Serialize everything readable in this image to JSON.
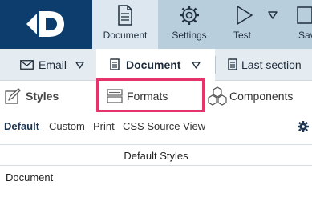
{
  "toolbar": {
    "document_label": "Document",
    "settings_label": "Settings",
    "test_label": "Test",
    "save_label": "Sav"
  },
  "tabs": {
    "email_label": "Email",
    "document_label": "Document",
    "last_section_label": "Last section"
  },
  "subtabs": {
    "styles_label": "Styles",
    "formats_label": "Formats",
    "components_label": "Components"
  },
  "views": {
    "default_label": "Default",
    "custom_label": "Custom",
    "print_label": "Print",
    "css_source_label": "CSS Source View"
  },
  "panel": {
    "header": "Default Styles",
    "first_row": "Document"
  },
  "colors": {
    "brand_navy": "#0c3d6c",
    "toolbar_bg": "#b9cedd",
    "highlight": "#e5336b"
  }
}
